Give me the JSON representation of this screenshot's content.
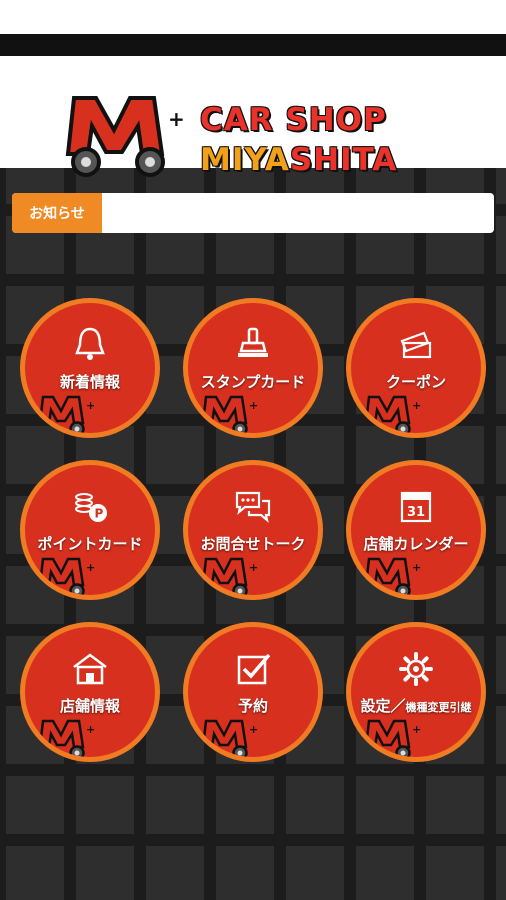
{
  "header": {
    "brand_line1": "CAR SHOP",
    "brand_line2_part1": "MIYA",
    "brand_line2_part2": "SHITA"
  },
  "notice": {
    "label": "お知らせ",
    "text": ""
  },
  "menu": [
    {
      "id": "news",
      "label": "新着情報",
      "icon": "bell-icon"
    },
    {
      "id": "stamp",
      "label": "スタンプカード",
      "icon": "stamp-icon"
    },
    {
      "id": "coupon",
      "label": "クーポン",
      "icon": "coupon-icon"
    },
    {
      "id": "point",
      "label": "ポイントカード",
      "icon": "coins-icon"
    },
    {
      "id": "talk",
      "label": "お問合せトーク",
      "icon": "chat-icon"
    },
    {
      "id": "calendar",
      "label": "店舗カレンダー",
      "icon": "calendar-icon",
      "calendar_day": "31"
    },
    {
      "id": "store",
      "label": "店舗情報",
      "icon": "store-icon"
    },
    {
      "id": "reserve",
      "label": "予約",
      "icon": "checkbox-icon"
    },
    {
      "id": "settings",
      "label": "設定／",
      "label_small": "機種変更引継",
      "icon": "gear-icon"
    }
  ],
  "colors": {
    "accent_red": "#d7301f",
    "accent_orange": "#f07b22",
    "notice_orange": "#f08a24",
    "bg": "#1c1c1c"
  }
}
